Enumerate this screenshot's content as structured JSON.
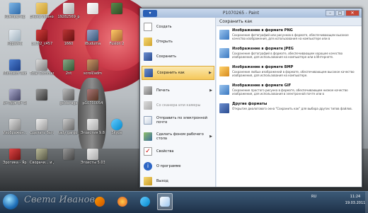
{
  "window": {
    "app_button": "▾",
    "title": "P1070265 - Paint",
    "minimize": "–",
    "maximize": "□",
    "close": "✕"
  },
  "menu": {
    "items": [
      {
        "label": "Создать"
      },
      {
        "label": "Открыть"
      },
      {
        "label": "Сохранить"
      },
      {
        "label": "Сохранить как",
        "arrow": "▶"
      },
      {
        "label": "Печать",
        "arrow": "▶"
      },
      {
        "label": "Со сканера или камеры"
      },
      {
        "label": "Отправить по электронной почте"
      },
      {
        "label": "Сделать фоном рабочего стола",
        "arrow": "▶"
      },
      {
        "label": "Свойства"
      },
      {
        "label": "О программе"
      },
      {
        "label": "Выход"
      }
    ]
  },
  "submenu": {
    "header": "Сохранить как",
    "items": [
      {
        "title": "Изображение в формате PNG",
        "desc": "Сохранение фотографий или рисунков в формате, обеспечивающем высокое качество изображения, для использования на компьютере или в"
      },
      {
        "title": "Изображение в формате JPEG",
        "desc": "Сохранение фотографий в формате, обеспечивающем хорошее качество изображения, для использования на компьютере или в Интернете."
      },
      {
        "title": "Изображение в формате BMP",
        "desc": "Сохранение любых изображений в формате, обеспечивающем высокое качество изображения, для использования на компьютере."
      },
      {
        "title": "Изображение в формате GIF",
        "desc": "Сохранение простого рисунка в формате, обеспечивающем низкое качество изображения, для использования в электронной почте или в"
      },
      {
        "title": "Другие форматы",
        "desc": "Открытие диалогового окна \"Сохранить как\" для выбора других типов файлов."
      }
    ]
  },
  "desktop_icons": [
    {
      "label": "Компьютер"
    },
    {
      "label": "Елена Иванова"
    },
    {
      "label": "19282569_p"
    },
    {
      "label": "Корзина"
    },
    {
      "label": "8_f3f2_c457"
    },
    {
      "label": "Microsoft Word Starter"
    },
    {
      "label": "Total Commander"
    },
    {
      "label": "Ьт-Эдж Вт Sterel-Оис..."
    },
    {
      "label": "Изображен... - Ярлык"
    },
    {
      "label": "Сделать бы с Интернет..."
    },
    {
      "label": "tady gargo_"
    },
    {
      "label": "Эротика - Ярлык"
    },
    {
      "label": "Сворачи... и Дрю Иссас..."
    },
    {
      "label": "1660"
    },
    {
      "label": "IBuduma"
    },
    {
      "label": "Fusion 2"
    },
    {
      "label": "gelderage"
    },
    {
      "label": "scroll/adm"
    },
    {
      "label": "p10730054"
    },
    {
      "label": "2nt"
    },
    {
      "label": "Skype"
    },
    {
      "label": "Эгоистия 9.83"
    },
    {
      "label": "Эгоисты 5.03"
    }
  ],
  "taskbar": {
    "clock_time": "11:24",
    "clock_date": "19.03.2011",
    "tray_lang": "RU"
  },
  "watermark": "Света Иванова",
  "colors": {
    "selected_menu": "#f5c75a",
    "title_blue": "#2a5fb5",
    "close_red": "#c84636",
    "taskbar": "#1d3048"
  }
}
